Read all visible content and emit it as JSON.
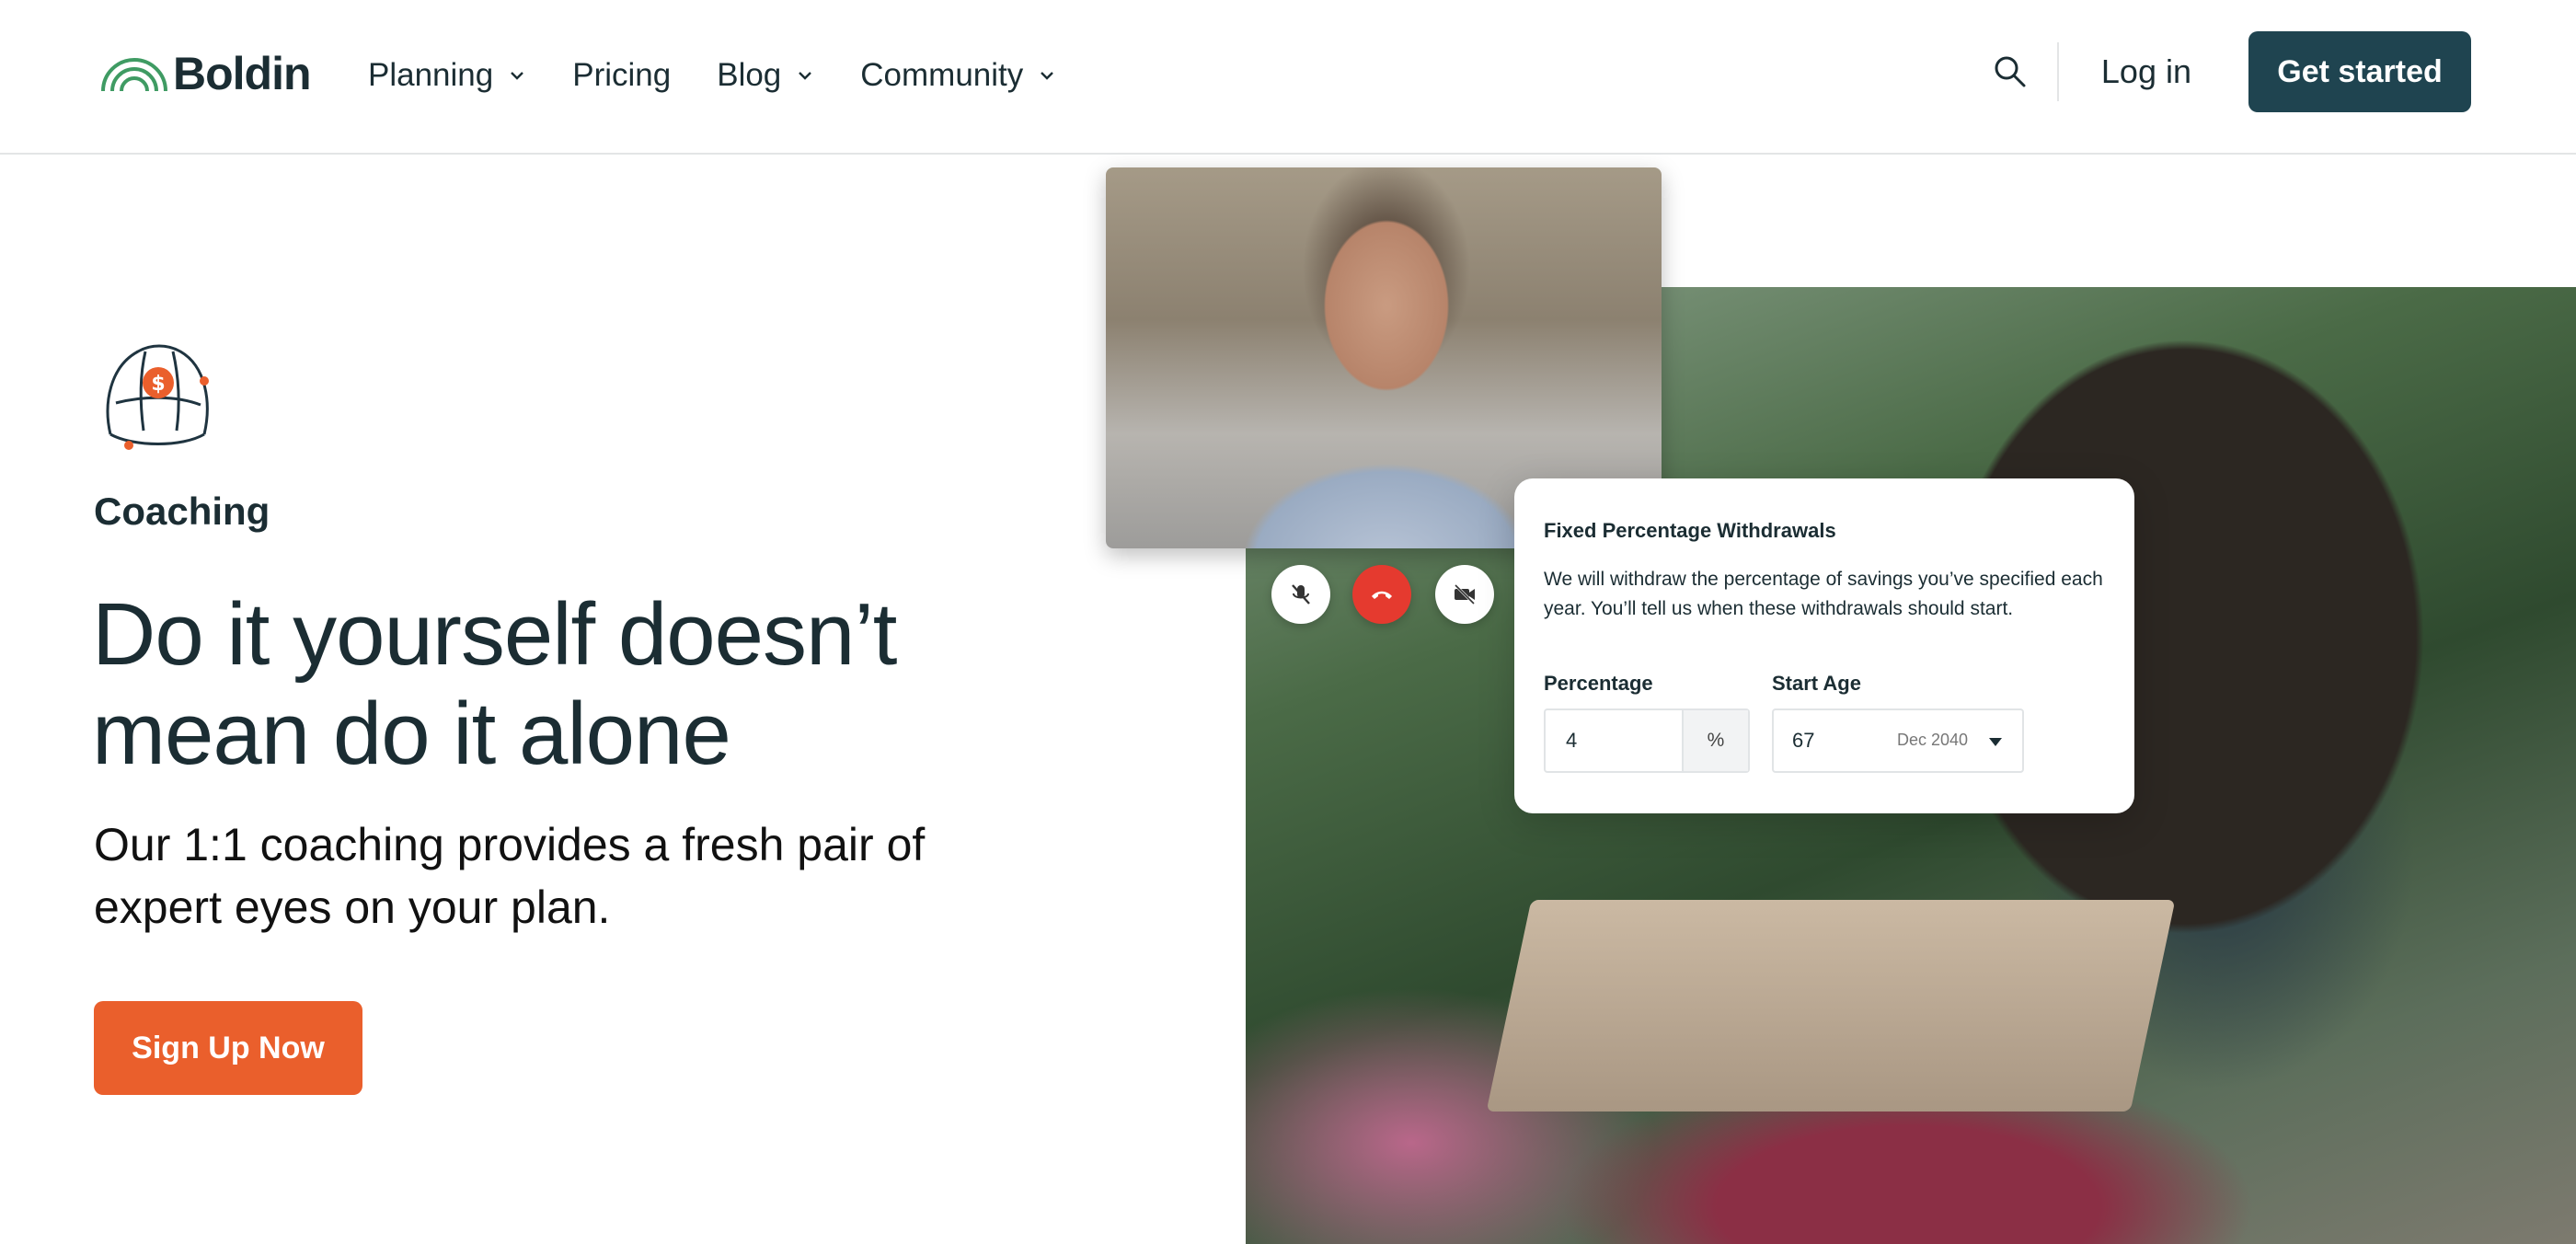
{
  "brand": {
    "name": "Boldin",
    "accent": "#1f4450",
    "cta_color": "#ea5f2c",
    "logo_green": "#3f9b63"
  },
  "nav": {
    "items": [
      {
        "label": "Planning",
        "has_dropdown": true
      },
      {
        "label": "Pricing",
        "has_dropdown": false
      },
      {
        "label": "Blog",
        "has_dropdown": true
      },
      {
        "label": "Community",
        "has_dropdown": true
      }
    ],
    "search_icon": "search-icon",
    "login_label": "Log in",
    "cta_label": "Get started"
  },
  "hero": {
    "icon": "coaching-cap-icon",
    "eyebrow": "Coaching",
    "headline": "Do it yourself doesn’t mean do it alone",
    "subhead": "Our 1:1 coaching provides a fresh pair of expert eyes on your plan.",
    "cta_label": "Sign Up Now"
  },
  "video_call": {
    "controls": [
      "mic-off-icon",
      "end-call-icon",
      "camera-off-icon"
    ]
  },
  "card": {
    "title": "Fixed Percentage Withdrawals",
    "description": "We will withdraw the percentage of savings you’ve specified each year. You’ll tell us when these withdrawals should start.",
    "percentage": {
      "label": "Percentage",
      "value": "4",
      "suffix": "%"
    },
    "start_age": {
      "label": "Start Age",
      "value": "67",
      "hint": "Dec 2040"
    }
  }
}
